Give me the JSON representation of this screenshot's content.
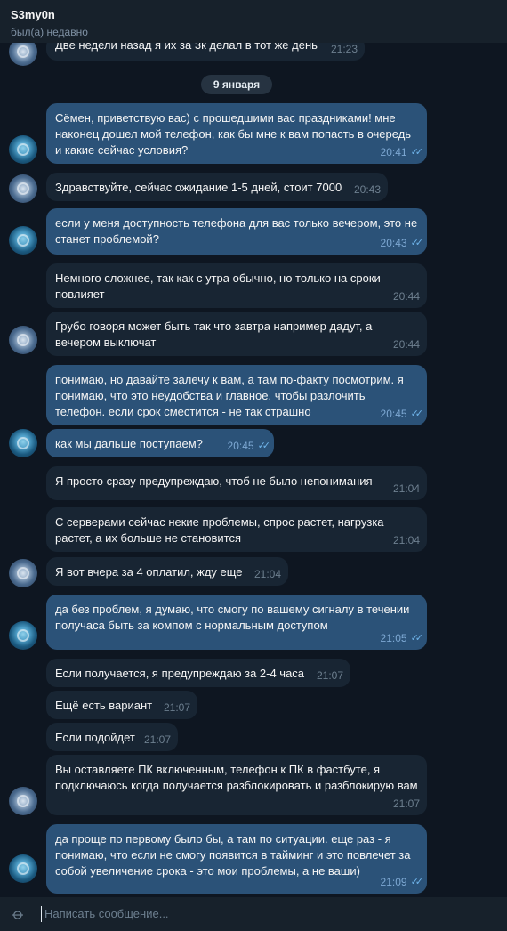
{
  "header": {
    "name": "S3my0n",
    "status": "был(а) недавно"
  },
  "date_separator": "9 января",
  "messages": [
    {
      "dir": "in",
      "text": "Две недели назад я их за 3к делал в тот же день",
      "time": "21:23"
    },
    {
      "dir": "out",
      "text": "Сёмен, приветствую вас) с прошедшими вас праздниками! мне наконец дошел мой телефон, как бы мне к вам попасть в очередь и какие сейчас условия?",
      "time": "20:41"
    },
    {
      "dir": "in",
      "text": "Здравствуйте, сейчас ожидание 1-5 дней, стоит 7000",
      "time": "20:43"
    },
    {
      "dir": "out",
      "text": "если у меня доступность телефона для вас только вечером, это не станет проблемой?",
      "time": "20:43"
    },
    {
      "dir": "in",
      "text": "Немного сложнее, так как с утра обычно, но только на сроки повлияет",
      "time": "20:44"
    },
    {
      "dir": "in",
      "text": "Грубо говоря может быть так что завтра например дадут, а вечером выключат",
      "time": "20:44"
    },
    {
      "dir": "out",
      "text": "понимаю, но давайте залечу к вам, а там по-факту посмотрим. я понимаю, что это неудобства и главное, чтобы разлочить телефон. если срок сместится - не так страшно",
      "time": "20:45"
    },
    {
      "dir": "out",
      "text": "как мы дальше поступаем?",
      "time": "20:45"
    },
    {
      "dir": "in",
      "text": "Я просто сразу предупреждаю, чтоб не было непонимания",
      "time": "21:04"
    },
    {
      "dir": "in",
      "text": "С серверами сейчас некие проблемы, спрос растет, нагрузка растет, а их больше не становится",
      "time": "21:04"
    },
    {
      "dir": "in",
      "text": "Я вот вчера за 4 оплатил, жду еще",
      "time": "21:04"
    },
    {
      "dir": "out",
      "text": "да без проблем, я думаю, что смогу по вашему сигналу в течении получаса быть за компом с нормальным доступом",
      "time": "21:05"
    },
    {
      "dir": "in",
      "text": "Если получается, я предупреждаю за 2-4 часа",
      "time": "21:07"
    },
    {
      "dir": "in",
      "text": "Ещё есть вариант",
      "time": "21:07"
    },
    {
      "dir": "in",
      "text": "Если подойдет",
      "time": "21:07"
    },
    {
      "dir": "in",
      "text": "Вы оставляете ПК включенным, телефон к ПК в фастбуте, я подключаюсь когда получается разблокировать и разблокирую вам",
      "time": "21:07"
    },
    {
      "dir": "out",
      "text": "да проще по первому было бы, а там по ситуации. еще раз - я понимаю, что если не смогу появится в тайминг и это повлечет за собой увеличение срока - это мои проблемы, а не ваши)",
      "time": "21:09"
    }
  ],
  "composer": {
    "placeholder": "Написать сообщение..."
  },
  "icons": {
    "attach": "paperclip-icon",
    "read": "double-check-icon"
  }
}
